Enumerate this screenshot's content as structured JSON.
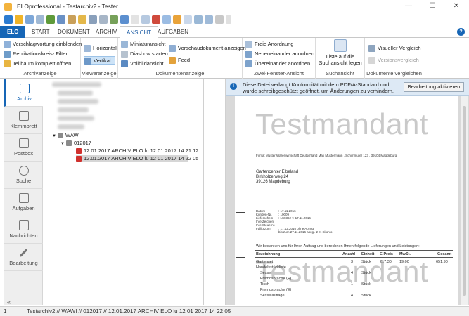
{
  "window": {
    "title": "ELOprofessional  -  Testarchiv2  -  Tester",
    "minimize": "—",
    "maximize": "☐",
    "close": "✕"
  },
  "tabs": [
    "ELO",
    "START",
    "DOKUMENT",
    "ARCHIV",
    "ANSICHT",
    "AUFGABEN"
  ],
  "active_tab": "ANSICHT",
  "help": "?",
  "ribbon": {
    "archivanzeige": {
      "label": "Archivanzeige",
      "items": [
        "Verschlagwortung einblenden",
        "Replikationskreis- Filter",
        "Teilbaum komplett öffnen"
      ]
    },
    "viewer": {
      "label": "Vieweranzeige",
      "items": [
        "Horizontal",
        "Vertikal"
      ]
    },
    "dokumentenanzeige": {
      "label": "Dokumentenanzeige",
      "items": [
        "Miniaturansicht",
        "Diashow starten",
        "Vollbildansicht"
      ],
      "items2": [
        "Vorschaudokument anzeigen",
        "Feed"
      ]
    },
    "zweifenster": {
      "label": "Zwei-Fenster-Ansicht",
      "items": [
        "Freie Anordnung",
        "Nebeneinander anordnen",
        "Übereinander anordnen"
      ]
    },
    "suchansicht": {
      "label": "Suchansicht",
      "button_line1": "Liste auf die",
      "button_line2": "Suchansicht legen"
    },
    "vergleichen": {
      "label": "Dokumente vergleichen",
      "items": [
        "Visueller Vergleich",
        "Versionsvergleich"
      ]
    }
  },
  "leftnav": [
    "Archiv",
    "Klemmbrett",
    "Postbox",
    "Suche",
    "Aufgaben",
    "Nachrichten",
    "Bearbeitung"
  ],
  "collapse": "«",
  "tree": {
    "nodes": [
      "WAWI",
      "012017",
      "12.01.2017  ARCHIV ELO lu 12 01 2017 14 21 12",
      "12.01.2017  ARCHIV ELO lu 12 01 2017 14 22 05"
    ]
  },
  "infobar": {
    "text": "Diese Datei verlangt Konformität mit dem PDF/A-Standard und wurde schreibgeschützt geöffnet, um Änderungen zu verhindern.",
    "button": "Bearbeitung aktivieren"
  },
  "document": {
    "watermark": "Testmandant",
    "sender": "Firma: Muster Warenwirtschaft Deutschland Max Mustermann , Schimmufer 123 , 39104 Magdeburg",
    "recipient": [
      "Gartencenter Elbeland",
      "Birkholzerweg 24",
      "39126 Magdeburg"
    ],
    "meta_labels": [
      "Datum",
      "Kunden-Nr.",
      "Lieferschein",
      "Ihre Zeichen",
      "Ihre Steuernr.",
      "Fällig zum"
    ],
    "meta_values": [
      ": 17.11.2016",
      ": 10009",
      ": LS0362 v. 17.11.2016",
      "",
      "",
      ": 17.12.2016 ohne Abzug"
    ],
    "meta_note": "bis zum 27.11.2016 abzgl. 2 % Skonto",
    "intro": "Wir bedanken uns für Ihren Auftrag und berechnen Ihnen folgende Lieferungen und Leistungen:",
    "table_headers": [
      "Bezeichnung",
      "Anzahl",
      "Einheit",
      "E-Preis",
      "MwSt.",
      "Gesamt"
    ],
    "rows": [
      {
        "name": "Gartenset",
        "qty": "3",
        "unit": "Stück",
        "price": "217,30",
        "vat": "19,00",
        "total": "651,90"
      },
      {
        "name": "Handelsstückliste",
        "qty": "",
        "unit": "",
        "price": "",
        "vat": "",
        "total": ""
      },
      {
        "name": "Sessel",
        "qty": "4",
        "unit": "Stück",
        "price": "",
        "vat": "",
        "total": ""
      },
      {
        "name": "Fremdsprache (E)",
        "qty": "",
        "unit": "",
        "price": "",
        "vat": "",
        "total": ""
      },
      {
        "name": "Tisch",
        "qty": "1",
        "unit": "Stück",
        "price": "",
        "vat": "",
        "total": ""
      },
      {
        "name": "Fremdsprache (E)",
        "qty": "",
        "unit": "",
        "price": "",
        "vat": "",
        "total": ""
      },
      {
        "name": "Sesselauflage",
        "qty": "4",
        "unit": "Stück",
        "price": "",
        "vat": "",
        "total": ""
      }
    ]
  },
  "status": {
    "count": "1",
    "path": "Testarchiv2 // WAWI // 012017 // 12.01.2017  ARCHIV ELO lu 12 01 2017 14 22 05"
  },
  "colors": {
    "accent": "#1666b6",
    "selection": "#d6d6d6",
    "infobar": "#dde9f5"
  }
}
